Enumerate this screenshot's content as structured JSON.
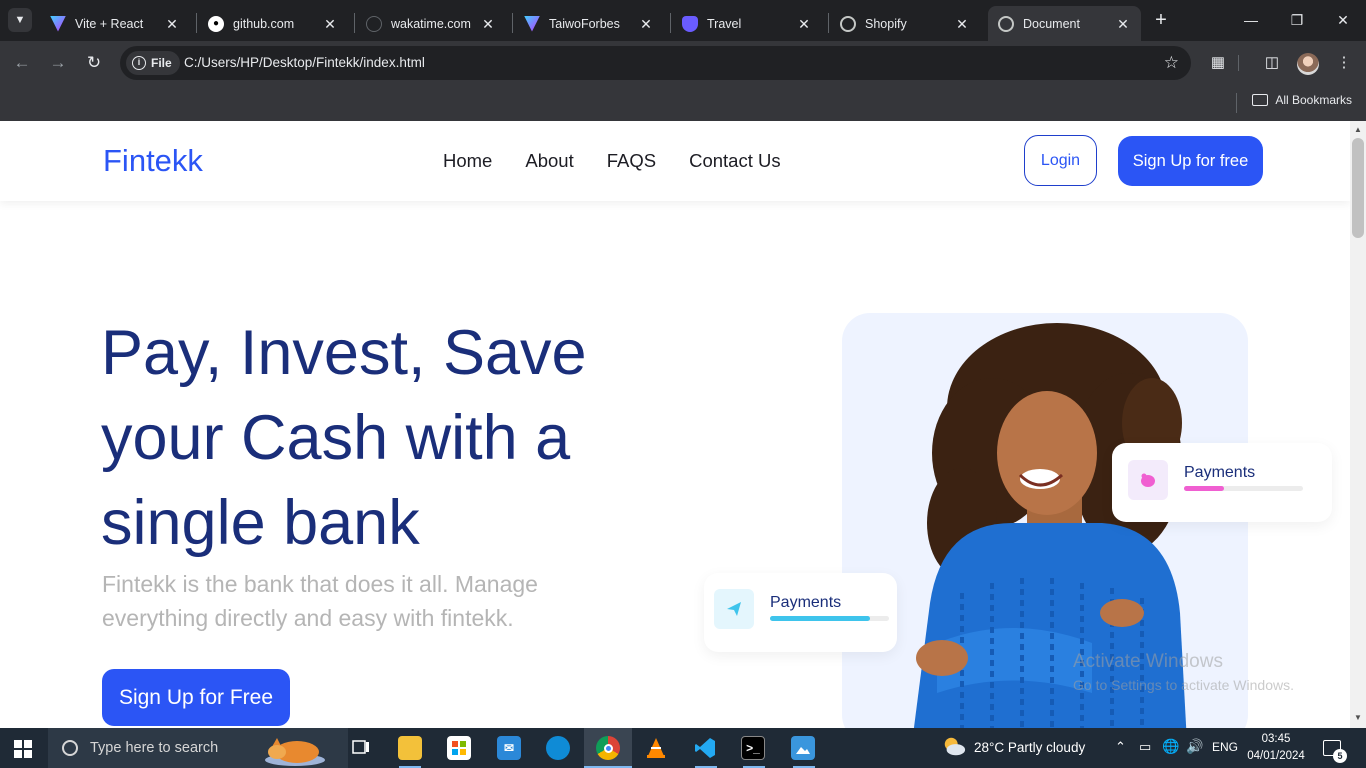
{
  "browser": {
    "tabs": [
      {
        "title": "Vite + React",
        "icon": "vite-icon"
      },
      {
        "title": "github.com",
        "icon": "github-icon"
      },
      {
        "title": "wakatime.com",
        "icon": "wakatime-icon"
      },
      {
        "title": "TaiwoForbes",
        "icon": "vite-icon"
      },
      {
        "title": "Travel",
        "icon": "shield-icon"
      },
      {
        "title": "Shopify",
        "icon": "globe-icon"
      },
      {
        "title": "Document",
        "icon": "globe-icon"
      }
    ],
    "active_tab_index": 6,
    "chip_label": "File",
    "url": "C:/Users/HP/Desktop/Fintekk/index.html",
    "bookmarks_label": "All Bookmarks"
  },
  "site": {
    "logo": "Fintekk",
    "nav": [
      "Home",
      "About",
      "FAQS",
      "Contact Us"
    ],
    "login_label": "Login",
    "signup_label": "Sign Up for free",
    "hero": {
      "title": "Pay, Invest, Save your Cash with a single bank",
      "subtitle": "Fintekk is the bank that does it all. Manage everything directly and easy with fintekk.",
      "cta_label": "Sign Up for Free"
    },
    "cards": [
      {
        "label": "Payments",
        "icon": "piggy-bank-icon",
        "progress": 0.34,
        "color": "#f05fd1"
      },
      {
        "label": "Payments",
        "icon": "paper-plane-icon",
        "progress": 0.84,
        "color": "#3ec4ec"
      }
    ]
  },
  "watermark": {
    "line1": "Activate Windows",
    "line2": "Go to Settings to activate Windows."
  },
  "taskbar": {
    "search_placeholder": "Type here to search",
    "weather": "28°C  Partly cloudy",
    "language": "ENG",
    "time": "03:45",
    "date": "04/01/2024",
    "notification_count": "5"
  },
  "colors": {
    "brand": "#2b55f5",
    "heading": "#1a2e7a",
    "subtle": "#b5b5b5"
  }
}
